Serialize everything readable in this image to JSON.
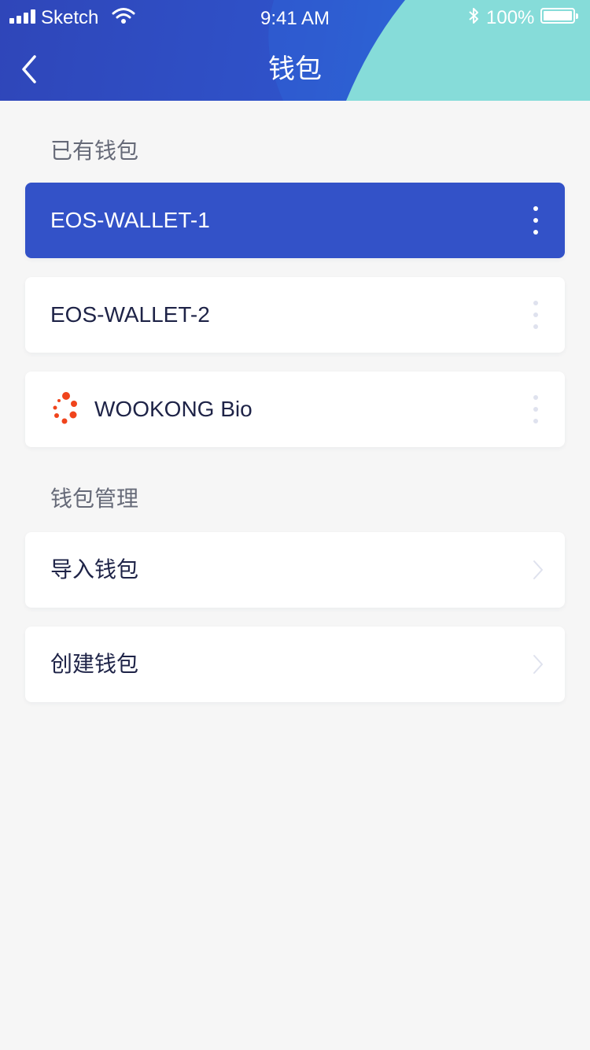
{
  "status_bar": {
    "carrier": "Sketch",
    "time": "9:41 AM",
    "battery": "100%"
  },
  "nav": {
    "title": "钱包",
    "back_icon": "chevron-left-icon"
  },
  "existing_wallets": {
    "section_label": "已有钱包",
    "items": [
      {
        "label": "EOS-WALLET-1",
        "selected": true,
        "menu_icon": "more-vertical-icon"
      },
      {
        "label": "EOS-WALLET-2",
        "selected": false,
        "menu_icon": "more-vertical-icon"
      },
      {
        "label": "WOOKONG Bio",
        "selected": false,
        "icon": "wookong-bio-icon",
        "menu_icon": "more-vertical-icon"
      }
    ]
  },
  "management": {
    "section_label": "钱包管理",
    "items": [
      {
        "label": "导入钱包",
        "icon": "chevron-right-icon"
      },
      {
        "label": "创建钱包",
        "icon": "chevron-right-icon"
      }
    ]
  },
  "colors": {
    "header_blue": "#2f4dbf",
    "header_teal": "#86dcd9",
    "accent": "#3352c8",
    "background": "#f6f6f6",
    "brand_orange": "#f0441c"
  }
}
